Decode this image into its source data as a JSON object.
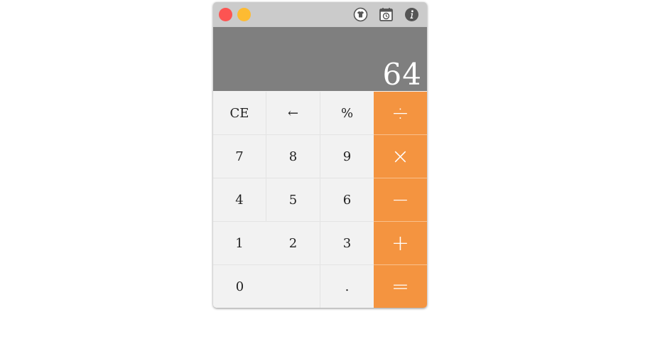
{
  "window": {
    "controls": {
      "close_color": "#fd5452",
      "minimize_color": "#fdbb32"
    },
    "toolbar_icons": [
      "theme-shirt-icon",
      "history-icon",
      "info-icon"
    ]
  },
  "display": {
    "value": "64",
    "background": "#7f7f7f"
  },
  "keys": {
    "ce": "CE",
    "backspace": "←",
    "percent": "%",
    "divide": "÷",
    "seven": "7",
    "eight": "8",
    "nine": "9",
    "multiply": "×",
    "four": "4",
    "five": "5",
    "six": "6",
    "minus": "−",
    "one": "1",
    "two": "2",
    "three": "3",
    "plus": "+",
    "zero": "0",
    "decimal": ".",
    "equals": "="
  },
  "colors": {
    "operator": "#f49440",
    "keypad": "#f2f2f2",
    "titlebar": "#cbcbcb"
  }
}
